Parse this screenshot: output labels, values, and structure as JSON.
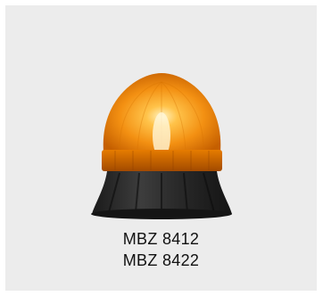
{
  "product": {
    "image_icon": "amber-beacon-light-icon",
    "models": [
      "MBZ 8412",
      "MBZ 8422"
    ],
    "colors": {
      "background": "#ececec",
      "dome": "#f59a12",
      "base": "#2c2c2c",
      "text": "#111111"
    }
  }
}
